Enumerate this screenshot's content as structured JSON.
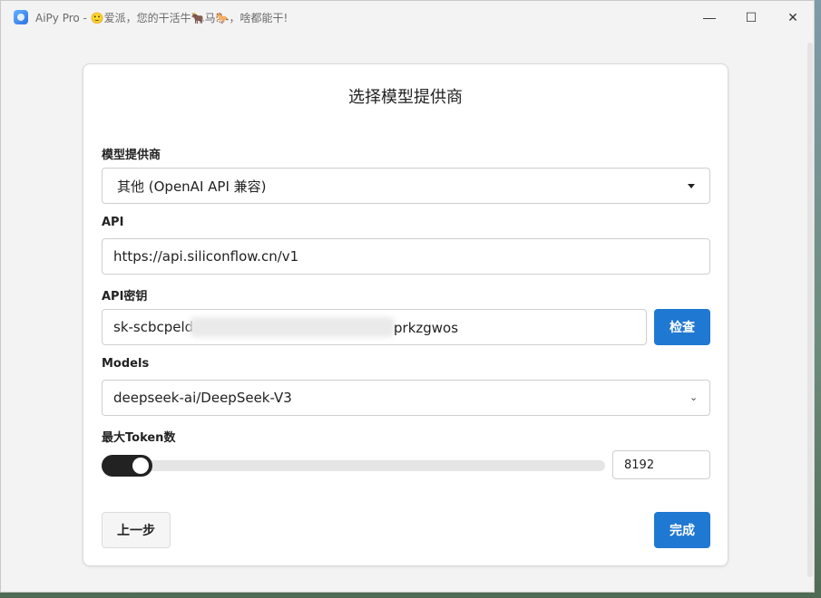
{
  "window": {
    "title": "AiPy Pro - 🙂爱派，您的干活牛🐂马🐎，啥都能干!",
    "controls": {
      "minimize": "—",
      "maximize": "☐",
      "close": "✕"
    }
  },
  "form": {
    "title": "选择模型提供商",
    "provider": {
      "label": "模型提供商",
      "value": "其他 (OpenAI API 兼容)"
    },
    "api": {
      "label": "API",
      "value": "https://api.siliconflow.cn/v1"
    },
    "api_key": {
      "label": "API密钥",
      "value_start": "sk-scbcpeld",
      "value_end": "prkzgwos",
      "check_button": "检查"
    },
    "models": {
      "label": "Models",
      "value": "deepseek-ai/DeepSeek-V3"
    },
    "max_tokens": {
      "label": "最大Token数",
      "value": "8192",
      "slider_fraction": 0.1
    },
    "back_button": "上一步",
    "finish_button": "完成"
  },
  "colors": {
    "primary": "#1f78d1",
    "slider": "#222222"
  }
}
